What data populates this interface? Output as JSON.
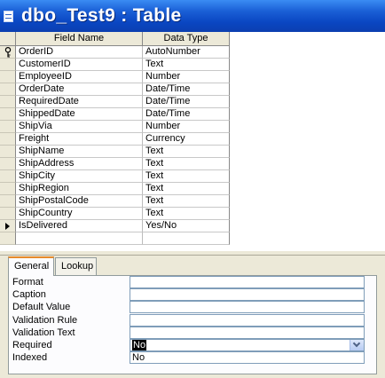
{
  "window": {
    "title": "dbo_Test9 : Table"
  },
  "columns": {
    "field_name": "Field Name",
    "data_type": "Data Type"
  },
  "fields": [
    {
      "name": "OrderID",
      "type": "AutoNumber",
      "marker": "key-icon"
    },
    {
      "name": "CustomerID",
      "type": "Text"
    },
    {
      "name": "EmployeeID",
      "type": "Number"
    },
    {
      "name": "OrderDate",
      "type": "Date/Time"
    },
    {
      "name": "RequiredDate",
      "type": "Date/Time"
    },
    {
      "name": "ShippedDate",
      "type": "Date/Time"
    },
    {
      "name": "ShipVia",
      "type": "Number"
    },
    {
      "name": "Freight",
      "type": "Currency"
    },
    {
      "name": "ShipName",
      "type": "Text"
    },
    {
      "name": "ShipAddress",
      "type": "Text"
    },
    {
      "name": "ShipCity",
      "type": "Text"
    },
    {
      "name": "ShipRegion",
      "type": "Text"
    },
    {
      "name": "ShipPostalCode",
      "type": "Text"
    },
    {
      "name": "ShipCountry",
      "type": "Text"
    },
    {
      "name": "IsDelivered",
      "type": "Yes/No",
      "marker": "current-row-arrow-icon"
    },
    {
      "name": "",
      "type": ""
    }
  ],
  "tabs": {
    "general": "General",
    "lookup": "Lookup",
    "active": "General"
  },
  "properties": [
    {
      "label": "Format",
      "value": ""
    },
    {
      "label": "Caption",
      "value": ""
    },
    {
      "label": "Default Value",
      "value": ""
    },
    {
      "label": "Validation Rule",
      "value": ""
    },
    {
      "label": "Validation Text",
      "value": ""
    },
    {
      "label": "Required",
      "value": "No",
      "selected": true
    },
    {
      "label": "Indexed",
      "value": "No"
    }
  ]
}
